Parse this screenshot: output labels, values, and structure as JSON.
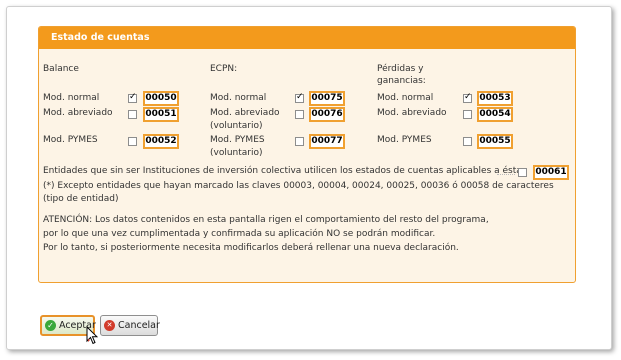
{
  "panel": {
    "title": "Estado de cuentas"
  },
  "columns": [
    {
      "header_line1": "Balance",
      "header_line2": ""
    },
    {
      "header_line1": "ECPN:",
      "header_line2": ""
    },
    {
      "header_line1": "Pérdidas y",
      "header_line2": "ganancias:"
    }
  ],
  "rows": {
    "balance": [
      {
        "label": "Mod. normal",
        "label2": "",
        "checked": true,
        "code": "00050"
      },
      {
        "label": "Mod. abreviado",
        "label2": "",
        "checked": false,
        "code": "00051"
      },
      {
        "label": "Mod. PYMES",
        "label2": "",
        "checked": false,
        "code": "00052"
      }
    ],
    "ecpn": [
      {
        "label": "Mod. normal",
        "label2": "",
        "checked": true,
        "code": "00075"
      },
      {
        "label": "Mod. abreviado",
        "label2": "(voluntario)",
        "checked": false,
        "code": "00076"
      },
      {
        "label": "Mod. PYMES",
        "label2": "(voluntario)",
        "checked": false,
        "code": "00077"
      }
    ],
    "pyg": [
      {
        "label": "Mod. normal",
        "label2": "",
        "checked": true,
        "code": "00053"
      },
      {
        "label": "Mod. abreviado",
        "label2": "",
        "checked": false,
        "code": "00054"
      },
      {
        "label": "Mod. PYMES",
        "label2": "",
        "checked": false,
        "code": "00055"
      }
    ]
  },
  "entities": {
    "text": "Entidades que sin ser Instituciones de inversión colectiva utilicen los estados de cuentas aplicables a éstas",
    "checked": false,
    "code": "00061",
    "note": "(*) Excepto entidades que hayan marcado las claves 00003, 00004, 00024, 00025, 00036 ó 00058 de caracteres (tipo de entidad)"
  },
  "warning": {
    "line1": "ATENCIÓN: Los datos contenidos en esta pantalla rigen el comportamiento del resto del programa,",
    "line2": "por lo que una vez cumplimentada y confirmada su aplicación NO se podrán modificar.",
    "line3": "Por lo tanto, si posteriormente necesita modificarlos deberá rellenar una nueva declaración."
  },
  "buttons": {
    "accept": "Aceptar",
    "cancel": "Cancelar"
  },
  "colors": {
    "accent": "#f39a1c",
    "panel_bg": "#fdf4e6"
  }
}
